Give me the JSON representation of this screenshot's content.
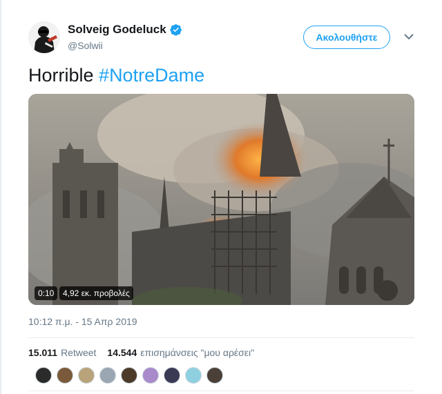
{
  "author": {
    "name": "Solveig Godeluck",
    "handle": "@Solwii",
    "verified": true
  },
  "follow_button_label": "Ακολουθήστε",
  "tweet_text_plain": "Horrible",
  "tweet_hashtag": "#NotreDame",
  "video": {
    "duration": "0:10",
    "views": "4,92 εκ. προβολές"
  },
  "timestamp": "10:12 π.μ. - 15 Απρ 2019",
  "stats": {
    "retweets_count": "15.011",
    "retweets_label": "Retweet",
    "likes_count": "14.544",
    "likes_label": "επισημάνσεις \"μου αρέσει\""
  },
  "likers": [
    "#2b2b2b",
    "#7a5a3a",
    "#b8a37a",
    "#9aa6b2",
    "#4d3b2a",
    "#a98acb",
    "#3a3a55",
    "#8fd0e0",
    "#4a4038"
  ],
  "icons": [
    "verified-badge-icon",
    "chevron-down-icon"
  ],
  "colors": {
    "accent": "#1da1f2",
    "text": "#14171a",
    "muted": "#657786",
    "divider": "#e6ecf0"
  }
}
